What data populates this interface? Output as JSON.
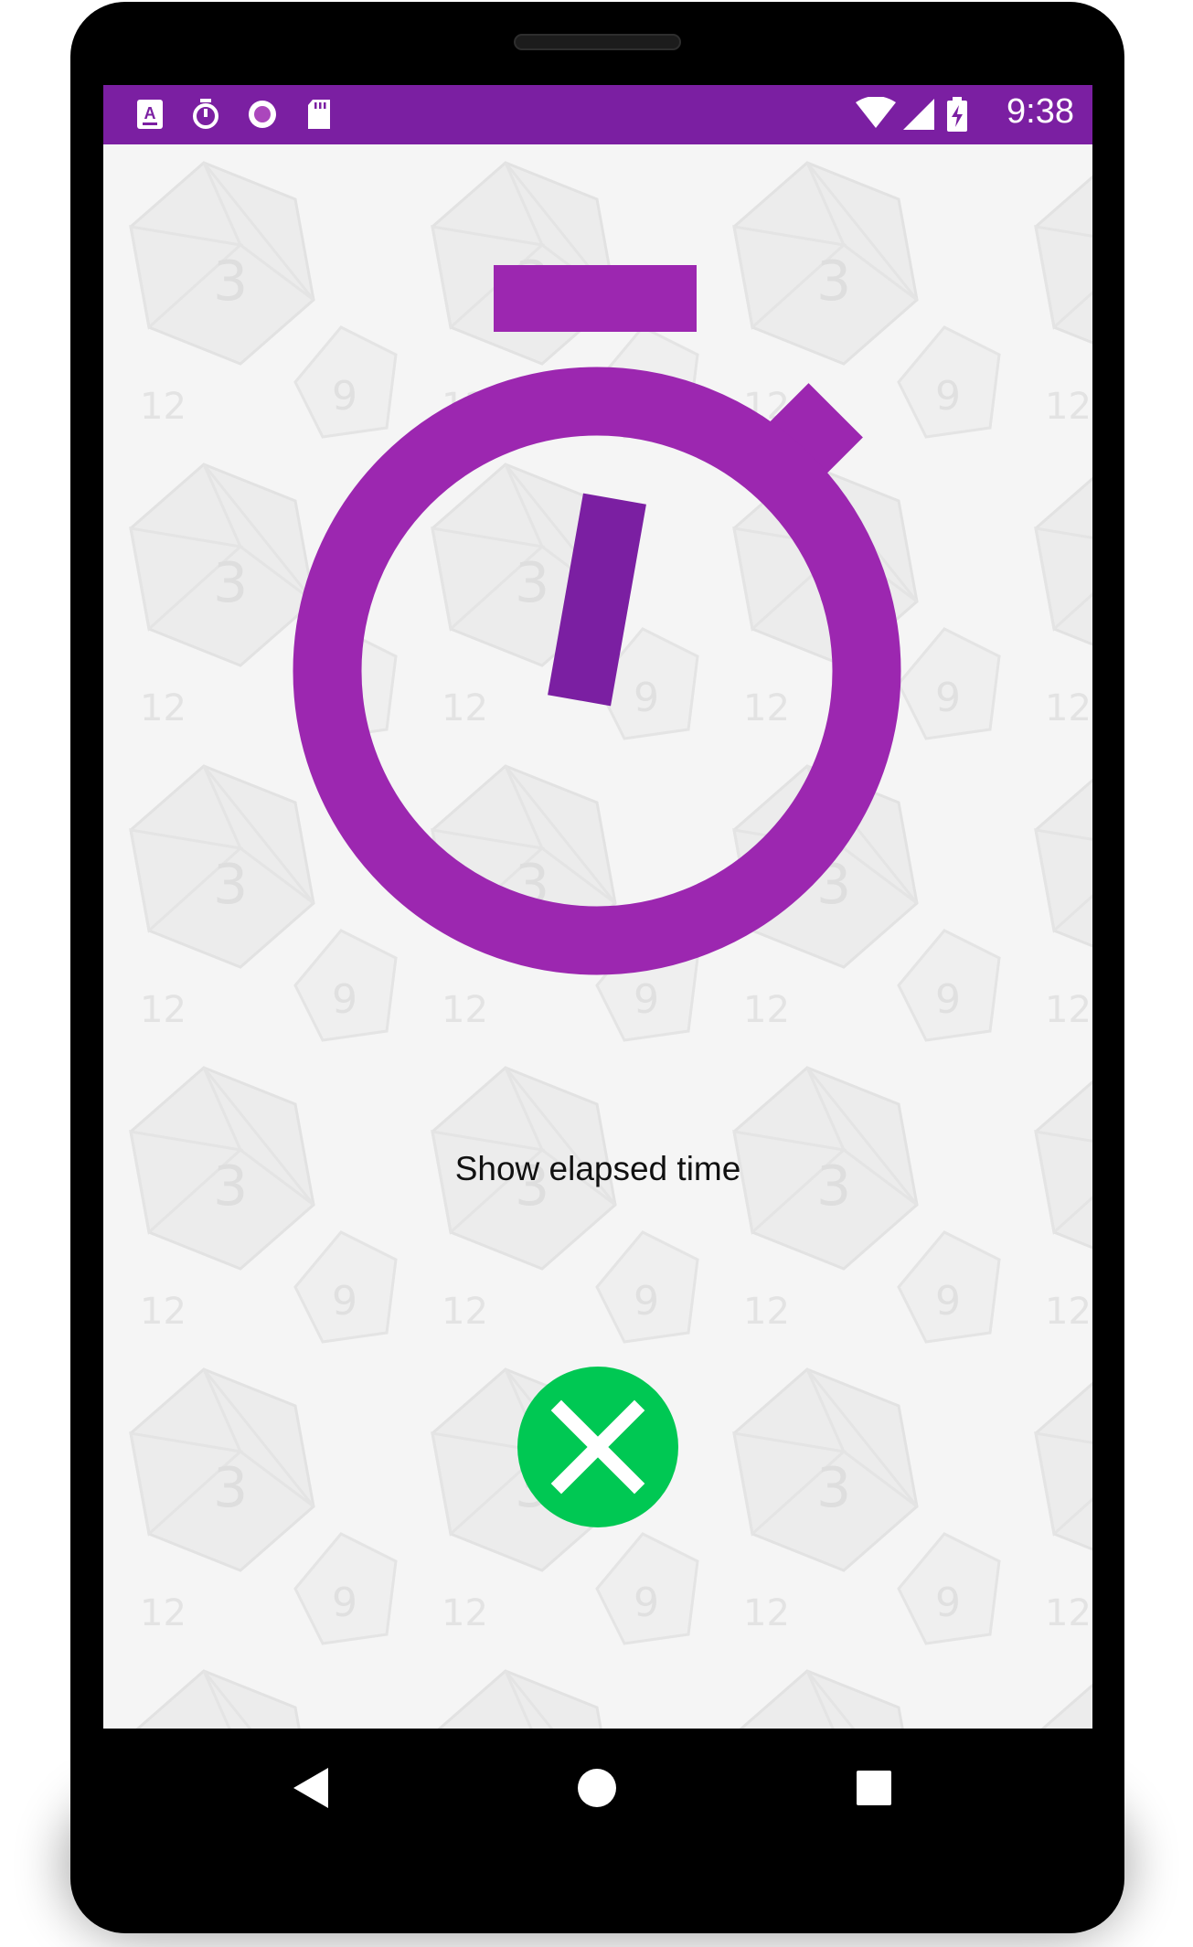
{
  "status_bar": {
    "time": "9:38",
    "left_icons": [
      "keyboard-a-icon",
      "stopwatch-icon",
      "record-circle-icon",
      "sd-card-icon"
    ],
    "right_icons": [
      "wifi-icon",
      "signal-icon",
      "battery-charging-icon"
    ],
    "background_color": "#7b1fa2"
  },
  "main": {
    "stopwatch_icon": "stopwatch-icon",
    "stopwatch_color": "#9c27b0",
    "hand_color": "#7b1fa2",
    "label": "Show elapsed time",
    "close_button_icon": "close-icon",
    "close_button_color": "#00c853"
  },
  "nav_bar": {
    "buttons": [
      "back-icon",
      "home-icon",
      "recents-icon"
    ]
  }
}
